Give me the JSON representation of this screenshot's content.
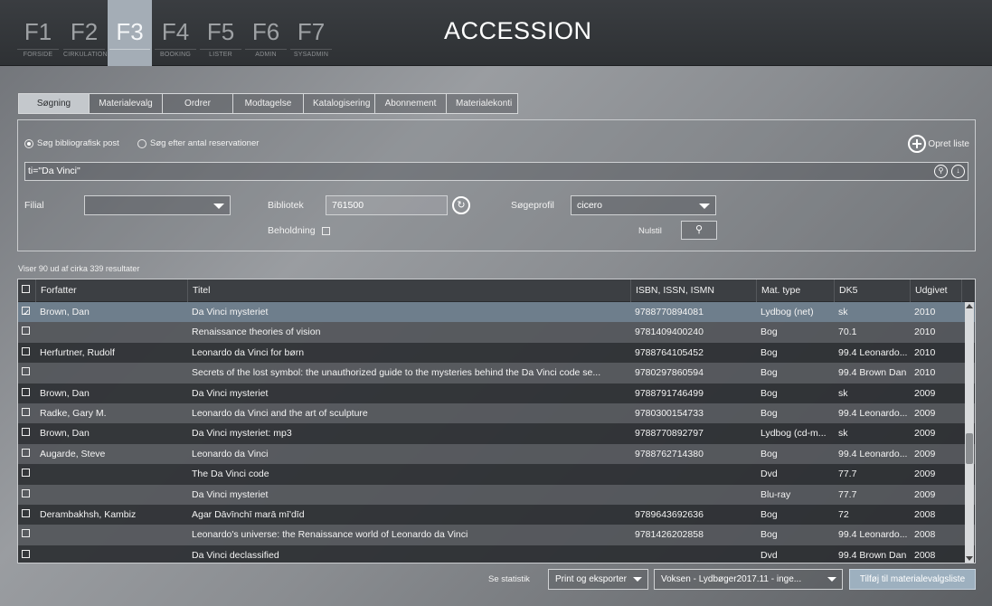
{
  "nav": {
    "keys": [
      {
        "key": "F1",
        "label": "FORSIDE"
      },
      {
        "key": "F2",
        "label": "CIRKULATION"
      },
      {
        "key": "F3",
        "label": ""
      },
      {
        "key": "F4",
        "label": "BOOKING"
      },
      {
        "key": "F5",
        "label": "LISTER"
      },
      {
        "key": "F6",
        "label": "ADMIN"
      },
      {
        "key": "F7",
        "label": "SYSADMIN"
      }
    ],
    "active": "F3"
  },
  "app_title": "ACCESSION",
  "tabs": [
    "Søgning",
    "Materialevalg",
    "Ordrer",
    "Modtagelse",
    "Katalogisering",
    "Abonnement",
    "Materialekonti"
  ],
  "search": {
    "radio1": "Søg bibliografisk post",
    "radio2": "Søg efter antal reservationer",
    "opret_liste": "Opret liste",
    "query": "ti=\"Da Vinci\"",
    "filial_label": "Filial",
    "filial_value": "",
    "bibliotek_label": "Bibliotek",
    "bibliotek_value": "761500",
    "soegeprofil_label": "Søgeprofil",
    "soegeprofil_value": "cicero",
    "beholdning_label": "Beholdning",
    "nulstil_label": "Nulstil"
  },
  "results": {
    "count_text": "Viser 90 ud af cirka 339 resultater",
    "columns": [
      "",
      "Forfatter",
      "Titel",
      "ISBN, ISSN, ISMN",
      "Mat. type",
      "DK5",
      "Udgivet"
    ],
    "rows": [
      {
        "checked": true,
        "forfatter": "Brown, Dan",
        "titel": "Da Vinci mysteriet",
        "isbn": "9788770894081",
        "mat": "Lydbog (net)",
        "dk5": "sk",
        "udgivet": "2010"
      },
      {
        "checked": false,
        "forfatter": "",
        "titel": "Renaissance theories of vision",
        "isbn": "9781409400240",
        "mat": "Bog",
        "dk5": "70.1",
        "udgivet": "2010"
      },
      {
        "checked": false,
        "forfatter": "Herfurtner, Rudolf",
        "titel": "Leonardo da Vinci for børn",
        "isbn": "9788764105452",
        "mat": "Bog",
        "dk5": "99.4 Leonardo...",
        "udgivet": "2010"
      },
      {
        "checked": false,
        "forfatter": "",
        "titel": "Secrets of the lost symbol: the unauthorized guide to the mysteries behind the Da Vinci code se...",
        "isbn": "9780297860594",
        "mat": "Bog",
        "dk5": "99.4 Brown Dan",
        "udgivet": "2010"
      },
      {
        "checked": false,
        "forfatter": "Brown, Dan",
        "titel": "Da Vinci mysteriet",
        "isbn": "9788791746499",
        "mat": "Bog",
        "dk5": "sk",
        "udgivet": "2009"
      },
      {
        "checked": false,
        "forfatter": "Radke, Gary M.",
        "titel": "Leonardo da Vinci and the art of sculpture",
        "isbn": "9780300154733",
        "mat": "Bog",
        "dk5": "99.4 Leonardo...",
        "udgivet": "2009"
      },
      {
        "checked": false,
        "forfatter": "Brown, Dan",
        "titel": "Da Vinci mysteriet: mp3",
        "isbn": "9788770892797",
        "mat": "Lydbog (cd-m...",
        "dk5": "sk",
        "udgivet": "2009"
      },
      {
        "checked": false,
        "forfatter": "Augarde, Steve",
        "titel": "Leonardo da Vinci",
        "isbn": "9788762714380",
        "mat": "Bog",
        "dk5": "99.4 Leonardo...",
        "udgivet": "2009"
      },
      {
        "checked": false,
        "forfatter": "",
        "titel": "The Da Vinci code",
        "isbn": "",
        "mat": "Dvd",
        "dk5": "77.7",
        "udgivet": "2009"
      },
      {
        "checked": false,
        "forfatter": "",
        "titel": "Da Vinci mysteriet",
        "isbn": "",
        "mat": "Blu-ray",
        "dk5": "77.7",
        "udgivet": "2009"
      },
      {
        "checked": false,
        "forfatter": "Derambakhsh, Kambiz",
        "titel": "Agar Dāvīnchī marā mī'dīd",
        "isbn": "9789643692636",
        "mat": "Bog",
        "dk5": "72",
        "udgivet": "2008"
      },
      {
        "checked": false,
        "forfatter": "",
        "titel": "Leonardo's universe: the Renaissance world of Leonardo da Vinci",
        "isbn": "9781426202858",
        "mat": "Bog",
        "dk5": "99.4 Leonardo...",
        "udgivet": "2008"
      },
      {
        "checked": false,
        "forfatter": "",
        "titel": "Da Vinci declassified",
        "isbn": "",
        "mat": "Dvd",
        "dk5": "99.4 Brown Dan",
        "udgivet": "2008"
      }
    ]
  },
  "footer": {
    "se_statistik": "Se statistik",
    "print_eksporter": "Print og eksporter",
    "liste_value": "Voksen - Lydbøger2017.11 - inge...",
    "tilfoej": "Tilføj til materialevalgsliste"
  }
}
